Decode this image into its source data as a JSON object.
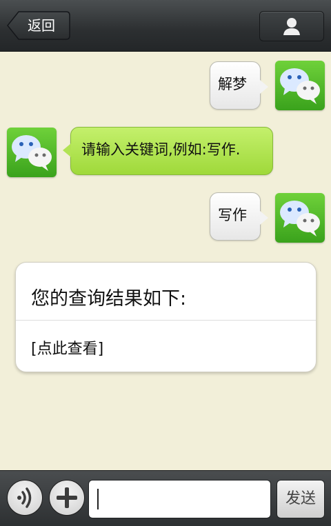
{
  "header": {
    "back_label": "返回",
    "contact_icon": "person-icon"
  },
  "messages": [
    {
      "side": "right",
      "style": "white",
      "text": "解梦"
    },
    {
      "side": "left",
      "style": "green",
      "text": "请输入关键词,例如:写作."
    },
    {
      "side": "right",
      "style": "white",
      "text": "写作"
    }
  ],
  "result_card": {
    "title": "您的查询结果如下:",
    "link": "[点此查看]"
  },
  "composer": {
    "voice_icon": "voice-icon",
    "plus_icon": "plus-icon",
    "input_value": "",
    "send_label": "发送"
  },
  "colors": {
    "background": "#f2efd9",
    "bubble_green": "#b2e354",
    "avatar_green": "#4db826"
  }
}
